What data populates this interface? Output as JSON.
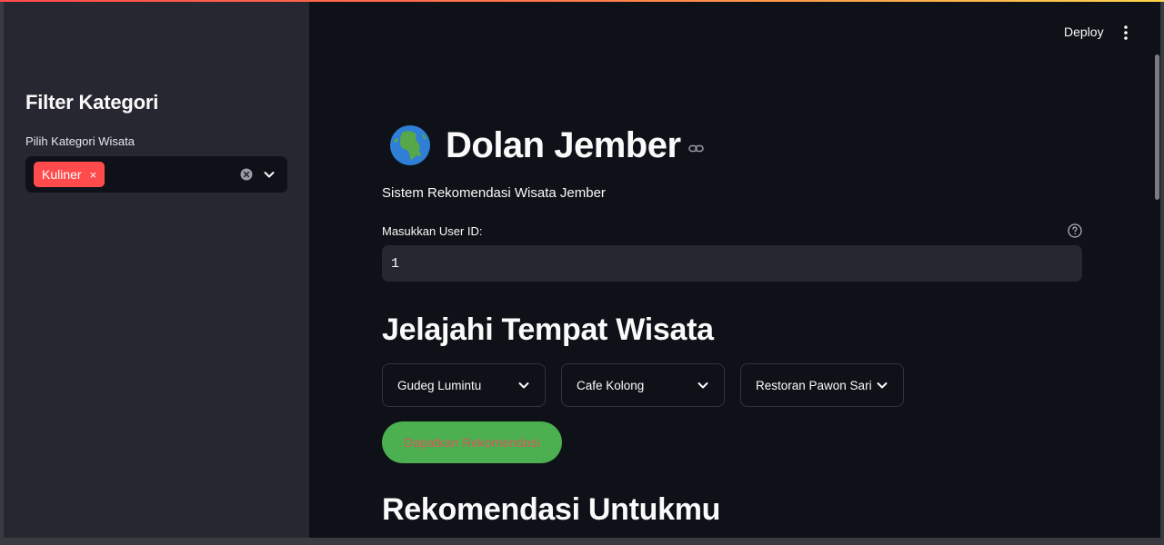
{
  "sidebar": {
    "title": "Filter Kategori",
    "category_label": "Pilih Kategori Wisata",
    "selected_chip": "Kuliner",
    "chip_remove_glyph": "×"
  },
  "header": {
    "deploy_label": "Deploy"
  },
  "main": {
    "title": "Dolan Jember",
    "subtitle": "Sistem Rekomendasi Wisata Jember",
    "user_id_label": "Masukkan User ID:",
    "user_id_value": "1",
    "explore_heading": "Jelajahi Tempat Wisata",
    "place_selects": [
      "Gudeg Lumintu",
      "Cafe Kolong",
      "Restoran Pawon Sari"
    ],
    "recommend_button": "Dapatkan Rekomendasi",
    "recommendations_heading": "Rekomendasi Untukmu"
  },
  "icons": {
    "title_icon": "globe-africa-icon",
    "anchor": "link-icon",
    "help": "question-circle-icon",
    "menu": "kebab-menu-icon",
    "dropdown": "chevron-down-icon",
    "clear": "clear-circle-icon"
  },
  "colors": {
    "accent": "#ff4b4b",
    "button_bg": "#4caf50",
    "app_bg": "#0e1117",
    "sidebar_bg": "#262730"
  }
}
